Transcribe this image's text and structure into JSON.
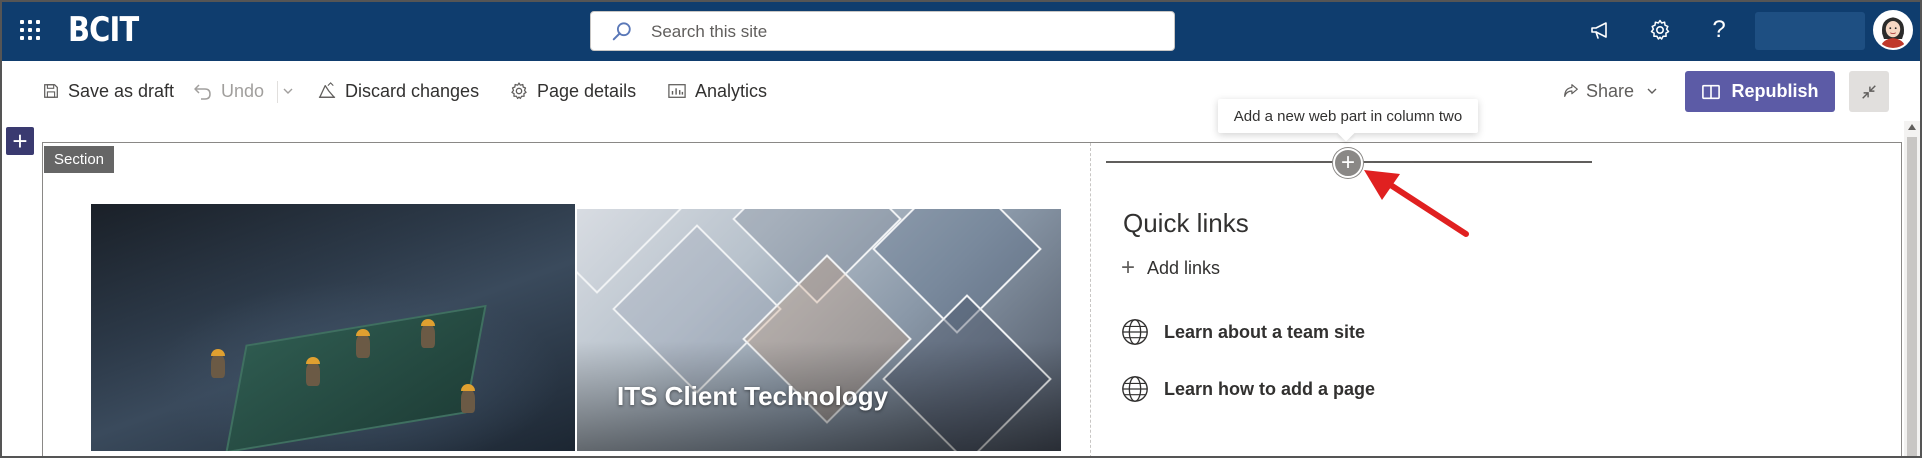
{
  "suitebar": {
    "brand": "BCIT",
    "search_placeholder": "Search this site",
    "icons": [
      "app-launcher-icon",
      "megaphone-icon",
      "gear-icon",
      "help-icon"
    ],
    "help_glyph": "?",
    "background": "#0f3d6e"
  },
  "commandbar": {
    "save_draft": "Save as draft",
    "undo": "Undo",
    "discard": "Discard changes",
    "page_details": "Page details",
    "analytics": "Analytics",
    "share": "Share",
    "republish": "Republish",
    "republish_color": "#5c5ba6"
  },
  "canvas": {
    "add_section_glyph": "+",
    "section_tag": "Section",
    "tooltip": "Add a new web part in column two",
    "add_webpart_glyph": "+"
  },
  "hero": {
    "tile2_title": "ITS Client Technology"
  },
  "quick_links": {
    "title": "Quick links",
    "add_links_glyph": "+",
    "add_links": "Add links",
    "items": [
      {
        "label": "Learn about a team site",
        "icon": "globe-icon"
      },
      {
        "label": "Learn how to add a page",
        "icon": "globe-icon"
      }
    ]
  },
  "colors": {
    "annotation_arrow": "#e02020"
  }
}
